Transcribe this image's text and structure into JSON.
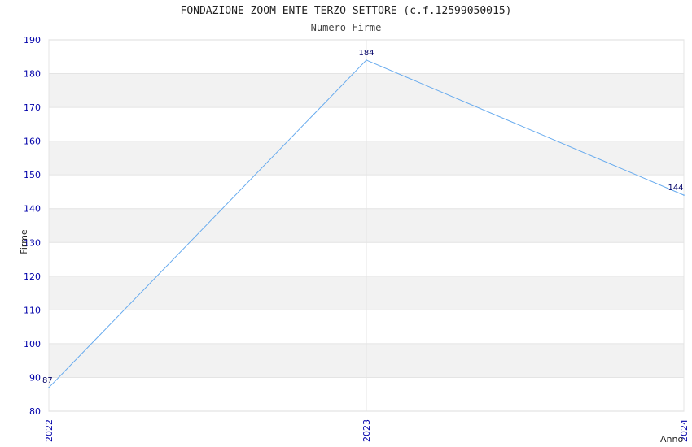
{
  "chart_data": {
    "type": "line",
    "title": "FONDAZIONE ZOOM ENTE TERZO SETTORE (c.f.12599050015)",
    "subtitle": "Numero Firme",
    "xlabel": "Anno",
    "ylabel": "Firme",
    "x": [
      "2022",
      "2023",
      "2024"
    ],
    "series": [
      {
        "values": [
          87,
          184,
          144
        ],
        "color": "#66aaee"
      }
    ],
    "data_labels": [
      "87",
      "184",
      "144"
    ],
    "ylim": [
      80,
      190
    ],
    "yticks": [
      "80",
      "90",
      "100",
      "110",
      "120",
      "130",
      "140",
      "150",
      "160",
      "170",
      "180",
      "190"
    ],
    "grid": true,
    "band_color": "#f2f2f2",
    "tick_color": "#0000aa"
  }
}
